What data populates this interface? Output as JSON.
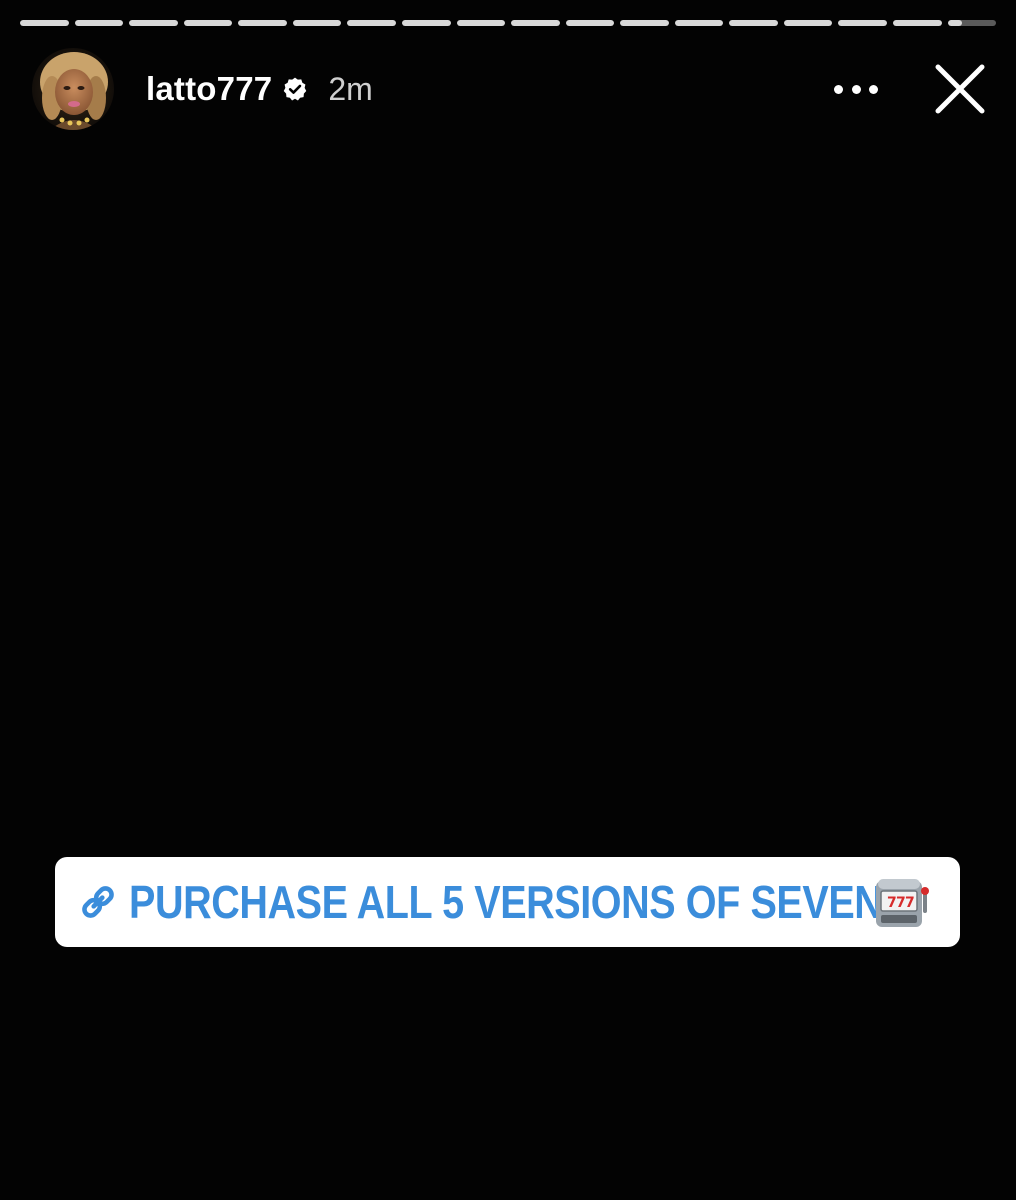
{
  "story": {
    "progress_total_segments": 18,
    "progress_completed_segments": 17,
    "progress_current_fraction": 0.3
  },
  "header": {
    "username": "latto777",
    "verified": true,
    "time_ago": "2m"
  },
  "link_sticker": {
    "label": "PURCHASE ALL 5 VERSIONS OF SEVEN",
    "icon": "link-icon",
    "emoji": "slot-machine-icon"
  },
  "colors": {
    "background": "#030303",
    "sticker_text": "#3b8ddb",
    "sticker_bg": "#ffffff"
  }
}
